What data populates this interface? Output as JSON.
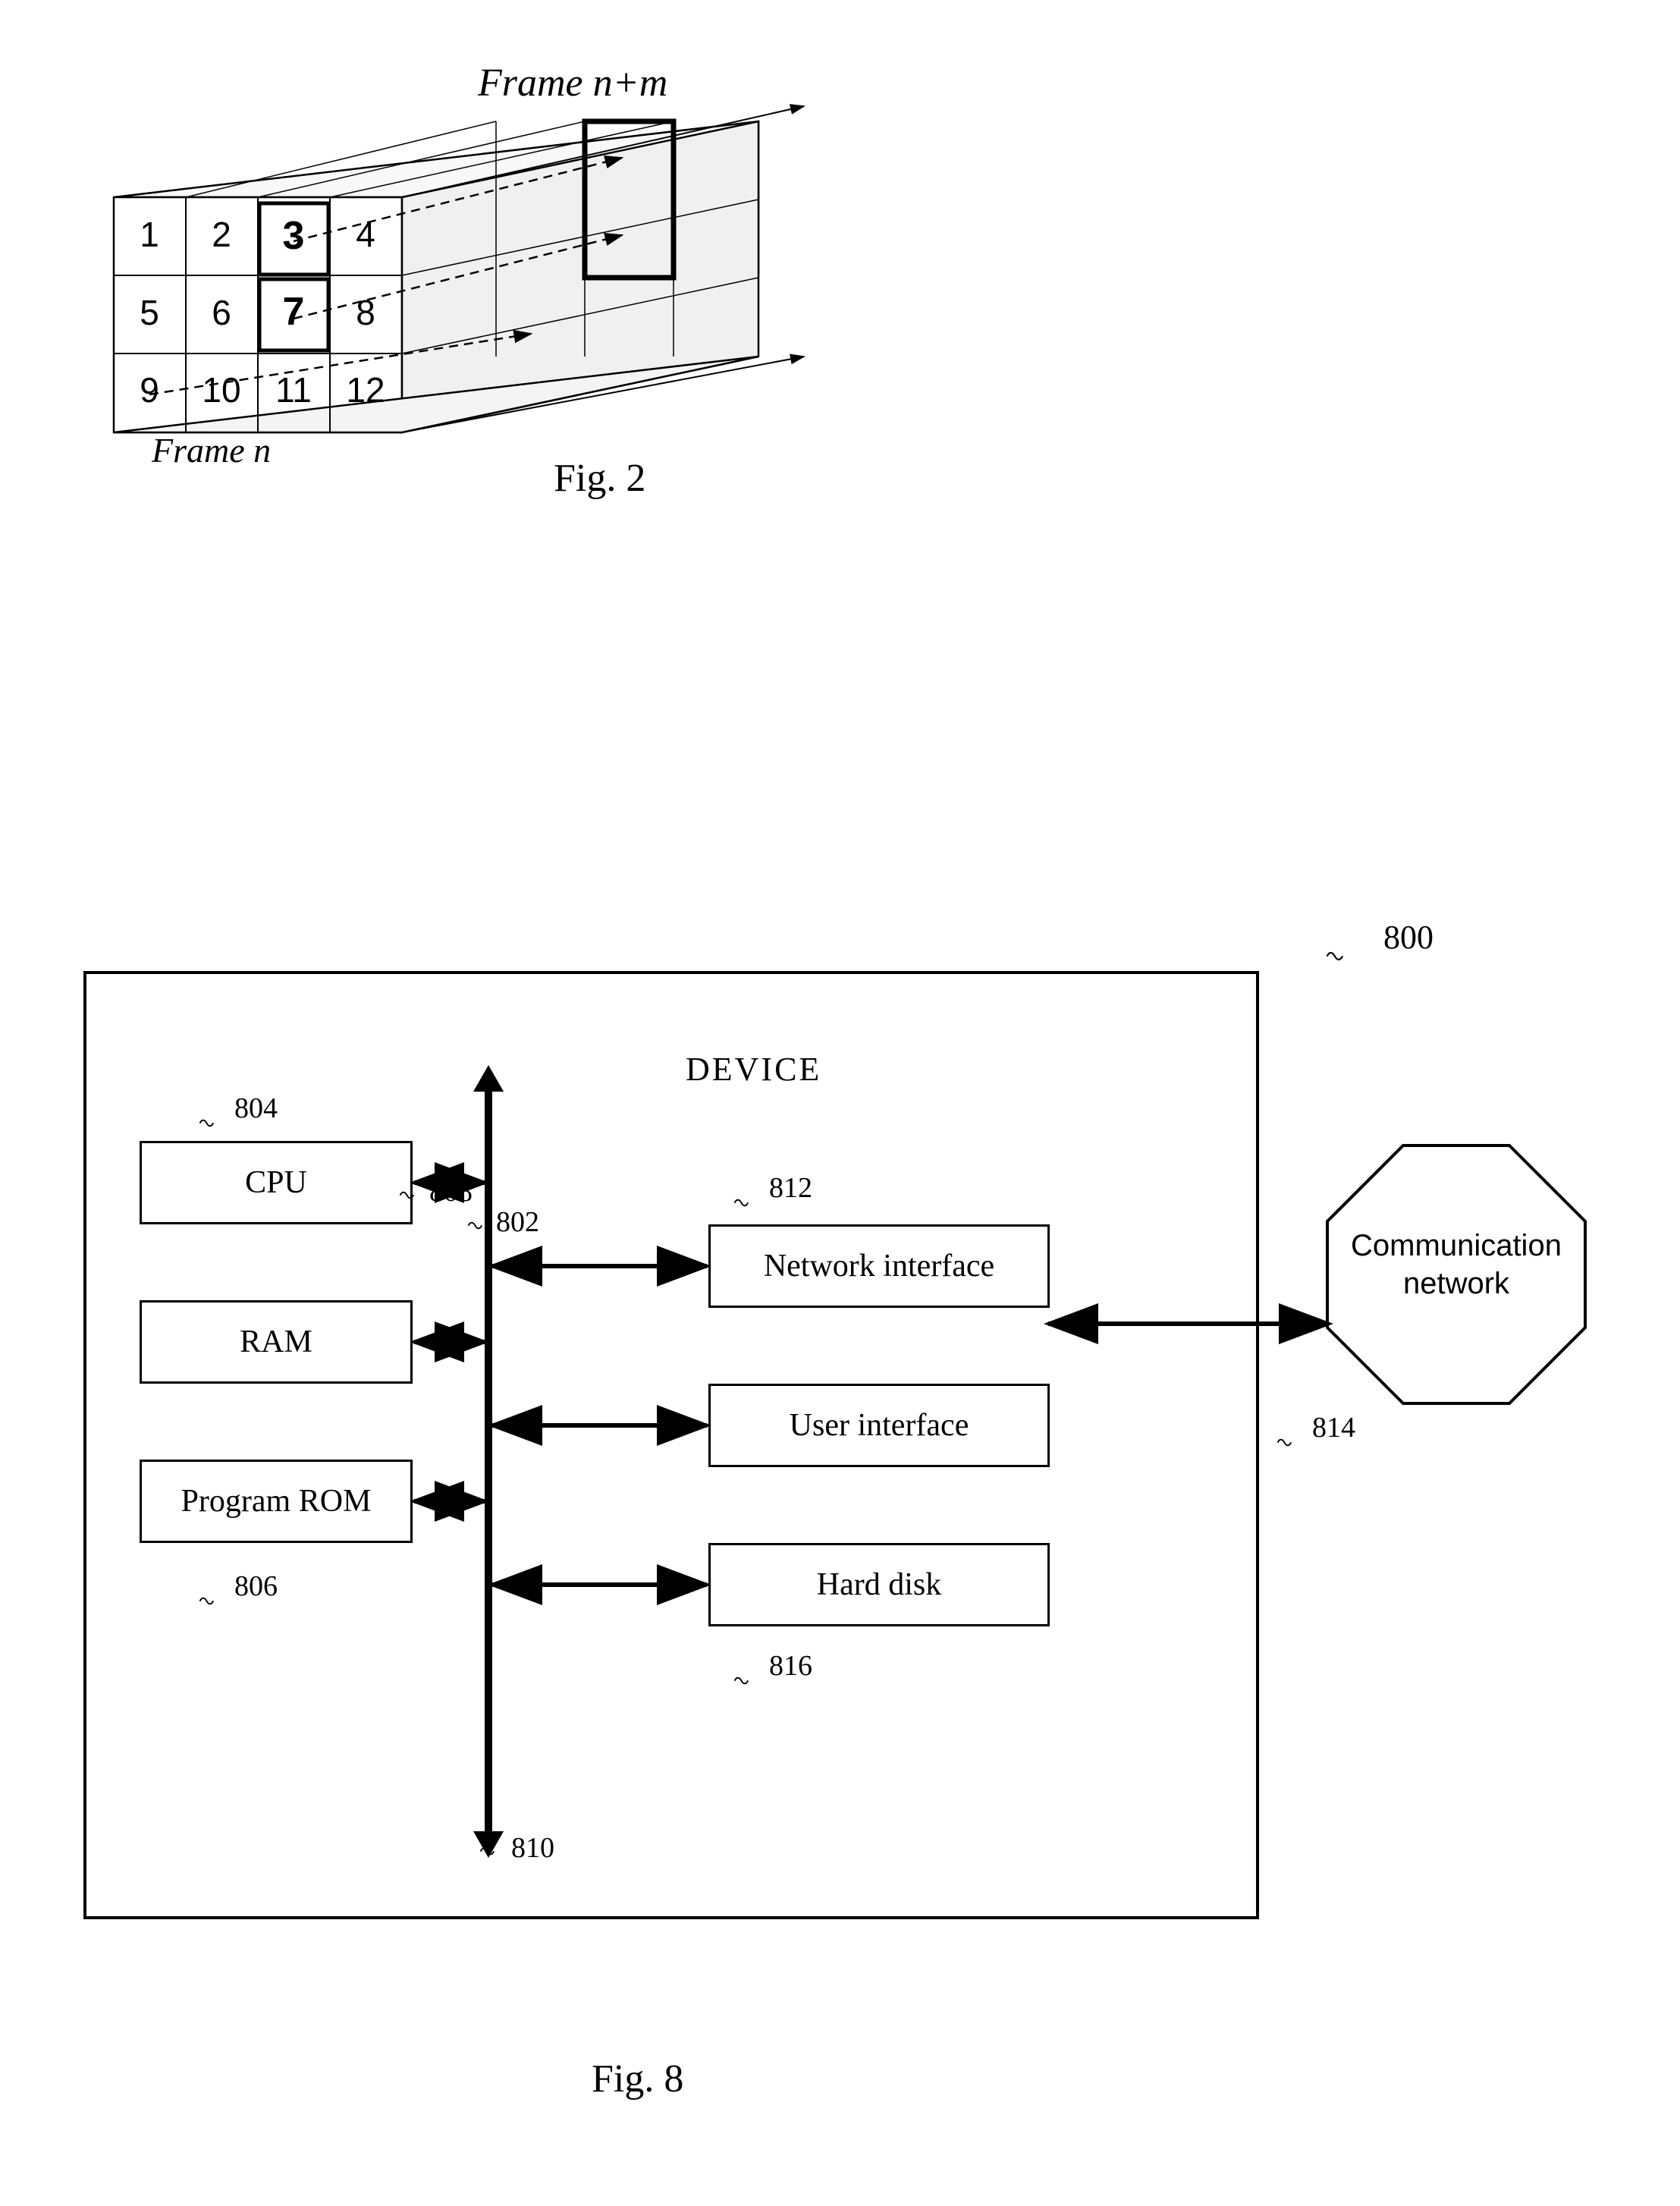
{
  "fig2": {
    "title": "Frame n+m",
    "frame_n_label": "Frame n",
    "caption": "Fig. 2",
    "grid": {
      "cells": [
        "1",
        "2",
        "3",
        "4",
        "5",
        "6",
        "7",
        "8",
        "9",
        "10",
        "11",
        "12"
      ]
    }
  },
  "fig8": {
    "caption": "Fig. 8",
    "ref_800": "800",
    "device_label": "DEVICE",
    "bus_ref_802": "802",
    "bus_ref_808": "808",
    "bus_ref_810": "810",
    "components": {
      "cpu": {
        "label": "CPU",
        "ref": "804"
      },
      "ram": {
        "label": "RAM"
      },
      "rom": {
        "label": "Program ROM",
        "ref": "806"
      },
      "netif": {
        "label": "Network interface",
        "ref": "812"
      },
      "userif": {
        "label": "User interface"
      },
      "hddisk": {
        "label": "Hard disk",
        "ref": "816"
      }
    },
    "comm_net": {
      "label": "Communication\nnetwork",
      "ref": "814"
    }
  }
}
